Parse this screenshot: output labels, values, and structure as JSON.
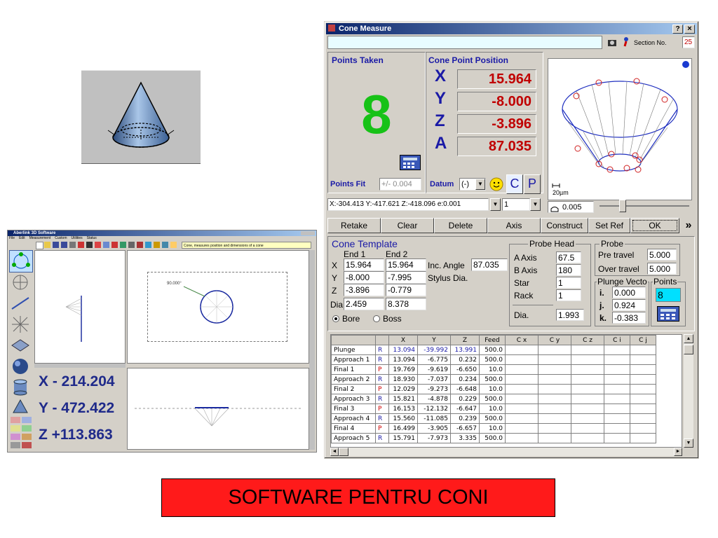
{
  "cone_window": {
    "title": "Cone Measure",
    "help_button": "?",
    "close_button": "×",
    "section_label": "Section No.",
    "section_value": "25",
    "points_taken_label": "Points Taken",
    "points_taken_value": "8",
    "cone_point_label": "Cone Point Position",
    "position": [
      {
        "axis": "X",
        "value": "15.964"
      },
      {
        "axis": "Y",
        "value": "-8.000"
      },
      {
        "axis": "Z",
        "value": "-3.896"
      },
      {
        "axis": "A",
        "value": "87.035"
      }
    ],
    "points_fit_label": "Points Fit",
    "points_fit_value": "+/- 0.004",
    "datum_label": "Datum",
    "datum_value": "(-)",
    "c_button": "C",
    "p_button": "P",
    "scale_label": "20µm",
    "coords_readout": "X:-304.413 Y:-417.621 Z:-418.096 e:0.001",
    "coord_select": "1",
    "tolerance_value": "0.005",
    "buttons": [
      "Retake",
      "Clear",
      "Delete",
      "Axis",
      "Construct",
      "Set Ref",
      "OK"
    ],
    "template": {
      "title": "Cone Template",
      "end1_label": "End 1",
      "end2_label": "End 2",
      "rows": [
        {
          "label": "X",
          "end1": "15.964",
          "end2": "15.964"
        },
        {
          "label": "Y",
          "end1": "-8.000",
          "end2": "-7.995"
        },
        {
          "label": "Z",
          "end1": "-3.896",
          "end2": "-0.779"
        },
        {
          "label": "Dia",
          "end1": "2.459",
          "end2": "8.378"
        }
      ],
      "inc_angle_label": "Inc. Angle",
      "inc_angle_value": "87.035",
      "stylus_dia_label": "Stylus Dia.",
      "bore_label": "Bore",
      "boss_label": "Boss"
    },
    "probe_head": {
      "title": "Probe Head",
      "a_axis_label": "A Axis",
      "a_axis_value": "67.5",
      "b_axis_label": "B Axis",
      "b_axis_value": "180",
      "star_label": "Star",
      "star_value": "1",
      "rack_label": "Rack",
      "rack_value": "1",
      "dia_label": "Dia.",
      "dia_value": "1.993"
    },
    "probe": {
      "title": "Probe",
      "pre_travel_label": "Pre travel",
      "pre_travel_value": "5.000",
      "over_travel_label": "Over travel",
      "over_travel_value": "5.000"
    },
    "plunge_vector": {
      "title": "Plunge Vecto",
      "i_label": "i.",
      "i_value": "0.000",
      "j_label": "j.",
      "j_value": "0.924",
      "k_label": "k.",
      "k_value": "-0.383"
    },
    "points_box": {
      "title": "Points",
      "value": "8"
    },
    "table": {
      "headers": [
        "",
        "",
        "X",
        "Y",
        "Z",
        "Feed",
        "C x",
        "C y",
        "C z",
        "C i",
        "C j"
      ],
      "rows": [
        {
          "name": "Plunge",
          "type": "R",
          "x": "13.094",
          "y": "-39.992",
          "z": "13.991",
          "feed": "500.0"
        },
        {
          "name": "Approach 1",
          "type": "R",
          "x": "13.094",
          "y": "-6.775",
          "z": "0.232",
          "feed": "500.0"
        },
        {
          "name": "Final 1",
          "type": "P",
          "x": "19.769",
          "y": "-9.619",
          "z": "-6.650",
          "feed": "10.0"
        },
        {
          "name": "Approach 2",
          "type": "R",
          "x": "18.930",
          "y": "-7.037",
          "z": "0.234",
          "feed": "500.0"
        },
        {
          "name": "Final 2",
          "type": "P",
          "x": "12.029",
          "y": "-9.273",
          "z": "-6.648",
          "feed": "10.0"
        },
        {
          "name": "Approach 3",
          "type": "R",
          "x": "15.821",
          "y": "-4.878",
          "z": "0.229",
          "feed": "500.0"
        },
        {
          "name": "Final 3",
          "type": "P",
          "x": "16.153",
          "y": "-12.132",
          "z": "-6.647",
          "feed": "10.0"
        },
        {
          "name": "Approach 4",
          "type": "R",
          "x": "15.560",
          "y": "-11.085",
          "z": "0.239",
          "feed": "500.0"
        },
        {
          "name": "Final 4",
          "type": "P",
          "x": "16.499",
          "y": "-3.905",
          "z": "-6.657",
          "feed": "10.0"
        },
        {
          "name": "Approach 5",
          "type": "R",
          "x": "15.791",
          "y": "-7.973",
          "z": "3.335",
          "feed": "500.0"
        }
      ]
    }
  },
  "sw_window": {
    "title": "Aberlink 3D Software",
    "menu": [
      "File",
      "Edit",
      "Measurement",
      "Custom",
      "Utilities",
      "Status"
    ],
    "hint": "Cone, measures position and dimensions of a cone",
    "angle_label": "90.000°",
    "readouts": [
      "X - 214.204",
      "Y - 472.422",
      "Z +113.863"
    ]
  },
  "banner": {
    "text": "SOFTWARE PENTRU CONI"
  },
  "colors": {
    "points_green": "#17c217",
    "value_red": "#c00000",
    "axis_blue": "#1a1aa6",
    "banner_red": "#ff1a1a",
    "title_blue": "#0a246a"
  }
}
